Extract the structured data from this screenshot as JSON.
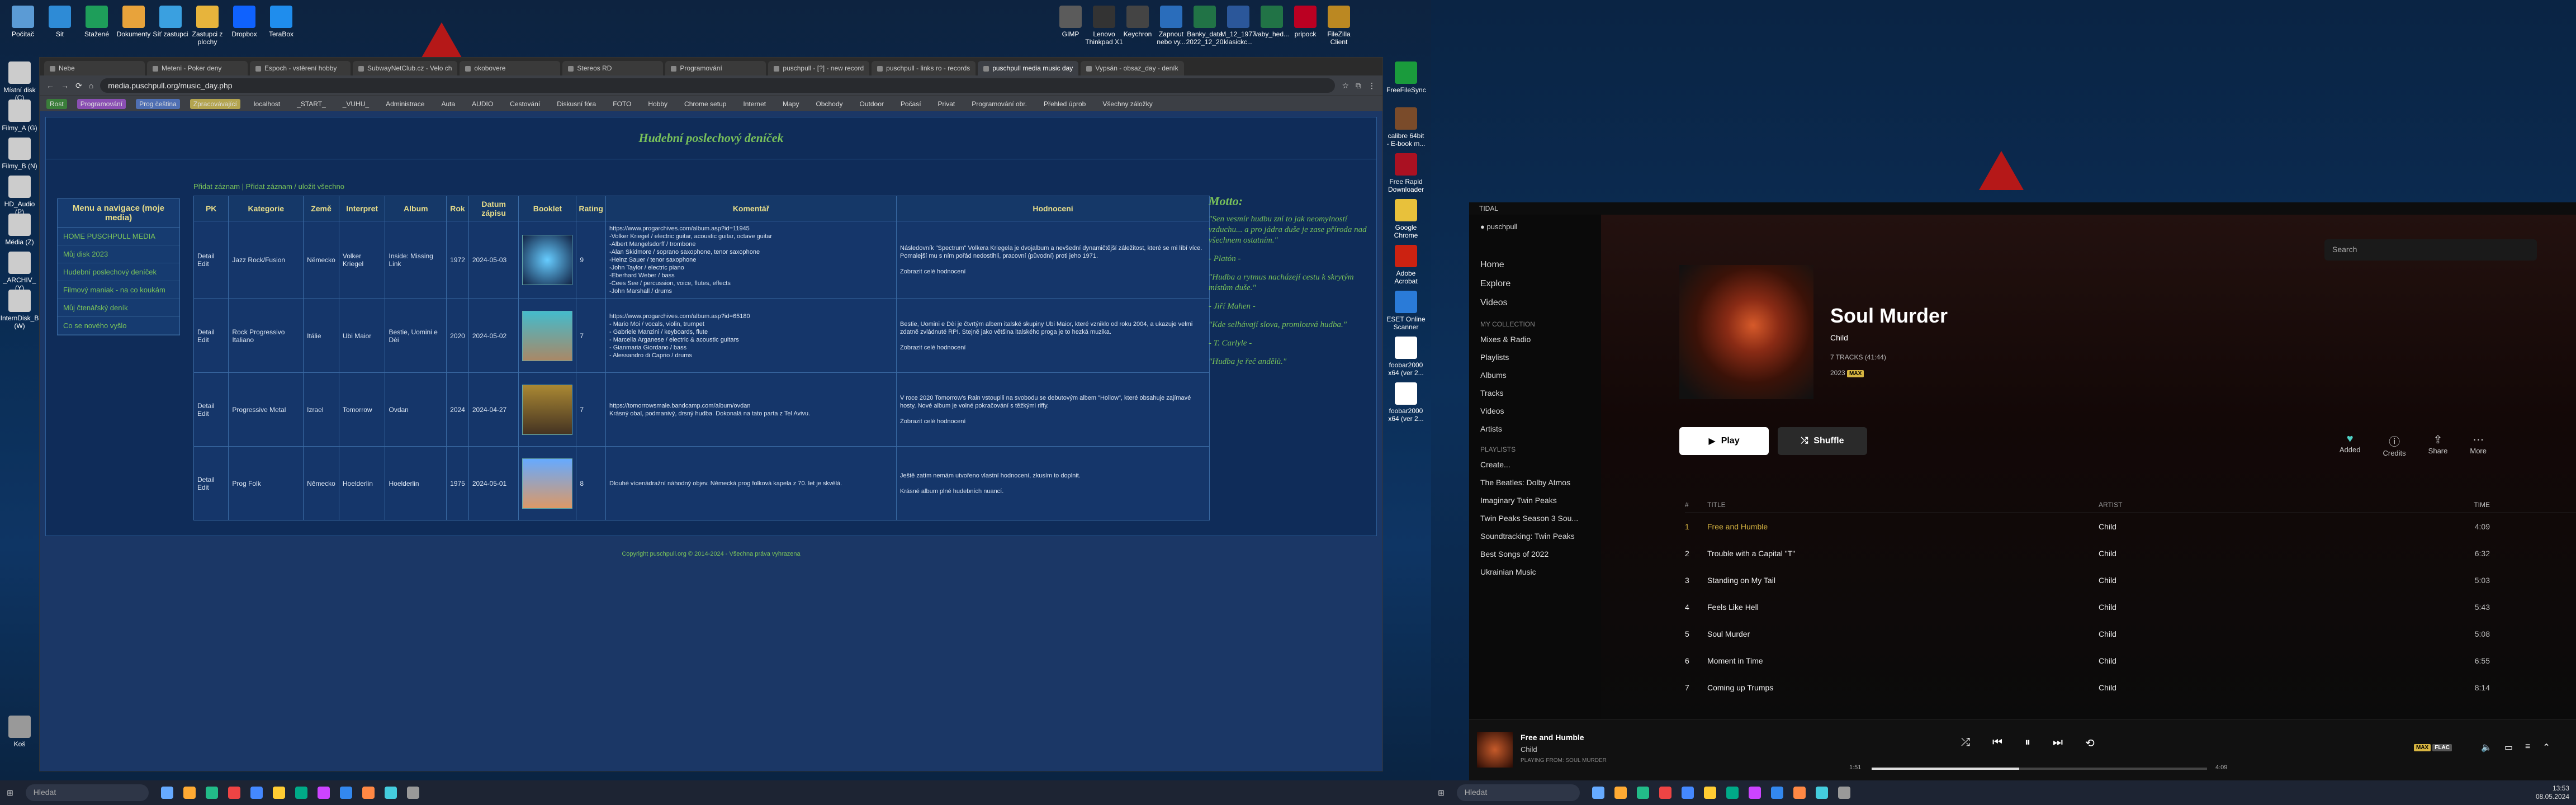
{
  "desktop": {
    "icons_top": [
      "Počítač",
      "Sit",
      "Stažené",
      "Dokumenty",
      "Síť zastupci",
      "Zastupci z plochy",
      "Dropbox",
      "TeraBox"
    ],
    "icons_right_top": [
      "GIMP",
      "Lenovo Thinkpad X1",
      "Keychron",
      "Zapnout nebo vy...",
      "Banky_data 2022_12_20",
      "M_12_1977 klasickc...",
      "vaby_hed...",
      "pripock",
      "FileZilla Client"
    ],
    "icons_left": [
      "Místní disk (C)",
      "Filmy_A (G)",
      "Filmy_B (N)",
      "HD_Audio (P)",
      "Média (Z)",
      "_ARCHIV_ (Y)",
      "InternDisk_B (W)",
      "Koš"
    ],
    "icons_right": [
      "FreeFileSync",
      "calibre 64bit - E-book m...",
      "Free Rapid Downloader",
      "Google Chrome",
      "Adobe Acrobat",
      "ESET Online Scanner",
      "foobar2000 x64 (ver 2...",
      "foobar2000 x64 (ver 2..."
    ]
  },
  "browser": {
    "tabs": [
      "Nebe",
      "Meteni - Poker deny",
      "Espoch - vstěrení hobby",
      "SubwayNetClub.cz - Velo ch",
      "okobovere",
      "Stereos RD",
      "Programování",
      "puschpull - [?] - new record",
      "puschpull - links ro - records",
      "puschpull media music day",
      "Vypsán - obsaz_day - deník"
    ],
    "active_tab": 9,
    "url": "media.puschpull.org/music_day.php",
    "bookmarks": [
      "Rost",
      "Programování",
      "Prog čeština",
      "Zpracovávající",
      "localhost",
      "_START_",
      "_VUHU_",
      "Administrace",
      "Auta",
      "AUDIO",
      "Cestování",
      "Diskusní fóra",
      "FOTO",
      "Hobby",
      "Chrome setup",
      "Internet",
      "Mapy",
      "Obchody",
      "Outdoor",
      "Počasí",
      "Privat",
      "Programování obr.",
      "Přehled úprob",
      "Všechny záložky"
    ]
  },
  "page": {
    "title": "Hudební poslechový deníček",
    "nav": "Přidat záznam   |   Přidat záznam / uložit všechno",
    "menu_title": "Menu a navigace (moje media)",
    "menu": [
      "HOME PUSCHPULL MEDIA",
      "Můj disk 2023",
      "Hudební poslechový deníček",
      "Filmový maniak - na co koukám",
      "Můj čtenářský deník",
      "Co se nového vyšlo"
    ],
    "headers": [
      "PK",
      "Kategorie",
      "Země",
      "Interpret",
      "Album",
      "Rok",
      "Datum zápisu",
      "Booklet",
      "Rating",
      "Komentář",
      "Hodnocení"
    ],
    "rows": [
      {
        "pk": "Detail Edit",
        "cat": "Jazz Rock/Fusion",
        "country": "Německo",
        "artist": "Volker Kriegel",
        "album": "Inside: Missing Link",
        "year": "1972",
        "date": "2024-05-03",
        "rating": "9",
        "comment": "https://www.progarchives.com/album.asp?id=11945\n-Volker Kriegel / electric guitar, acoustic guitar, octave guitar\n-Albert Mangelsdorff / trombone\n-Alan Skidmore / soprano saxophone, tenor saxophone\n-Heinz Sauer / tenor saxophone\n-John Taylor / electric piano\n-Eberhard Weber / bass\n-Cees See / percussion, voice, flutes, effects\n-John Marshall / drums",
        "rev": "Následovník \"Spectrum\" Volkera Kriegela je dvojalbum a nevšední dynamičtější záležitost, které se mi líbí více. Pomalejší mu s ním pořád nedostihli, pracovní (původní) proti jeho 1971.\n\nZobrazit celé hodnocení"
      },
      {
        "pk": "Detail Edit",
        "cat": "Rock Progressivo Italiano",
        "country": "Itálie",
        "artist": "Ubi Maior",
        "album": "Bestie, Uomini e Dèi",
        "year": "2020",
        "date": "2024-05-02",
        "rating": "7",
        "comment": "https://www.progarchives.com/album.asp?id=65180\n- Mario Moi / vocals, violin, trumpet\n- Gabriele Manzini / keyboards, flute\n- Marcella Arganese / electric & acoustic guitars\n- Gianmaria Giordano / bass\n- Alessandro di Caprio / drums",
        "rev": "Bestie, Uomini e Dèi je čtvrtým albem italské skupiny Ubi Maior, které vzniklo od roku 2004, a ukazuje velmi zdatně zvládnuté RPI. Stejně jako většina italského proga je to hezká muzika.\n\nZobrazit celé hodnocení"
      },
      {
        "pk": "Detail Edit",
        "cat": "Progressive Metal",
        "country": "Izrael",
        "artist": "Tomorrow",
        "album": "Ovdan",
        "year": "2024",
        "date": "2024-04-27",
        "rating": "7",
        "comment": "https://tomorrowsmale.bandcamp.com/album/ovdan\nKrásný obal, podmanivý, drsný hudba. Dokonalá na tato parta z Tel Avivu.",
        "rev": "V roce 2020 Tomorrow's Rain vstoupili na svobodu se debutovým albem \"Hollow\", které obsahuje zajímavé hosty. Nové album je volné pokračování s těžkými riffy.\n\nZobrazit celé hodnocení"
      },
      {
        "pk": "Detail Edit",
        "cat": "Prog Folk",
        "country": "Německo",
        "artist": "Hoelderlin",
        "album": "Hoelderlin",
        "year": "1975",
        "date": "2024-05-01",
        "rating": "8",
        "comment": "Dlouhé vícenádražní náhodný objev. Německá prog folková kapela z 70. let je skvělá.",
        "rev": "Ještě zatím nemám utvořeno vlastní hodnocení, zkusím to doplnit.\n\nKrásné album plné hudebních nuancí."
      }
    ],
    "motto_title": "Motto:",
    "motto": [
      "\"Sen vesmír hudbu zní to jak neomylností vzduchu... a pro jádra duše je zase příroda nad všechnem ostatním.\"",
      "- Platón -",
      "\"Hudba a rytmus nacházejí cestu k skrytým místům duše.\"",
      "- Jiří Mahen -",
      "\"Kde selhávají slova, promlouvá hudba.\"",
      "- T. Carlyle -",
      "\"Hudba je řeč andělů.\""
    ],
    "copyright": "Copyright puschpull.org © 2014-2024 - Všechna práva vyhrazena"
  },
  "tidal": {
    "window_title": "TIDAL",
    "user": "puschpull",
    "nav": [
      "Home",
      "Explore",
      "Videos"
    ],
    "collection_title": "MY COLLECTION",
    "collection": [
      "Mixes & Radio",
      "Playlists",
      "Albums",
      "Tracks",
      "Videos",
      "Artists"
    ],
    "playlists_title": "PLAYLISTS",
    "create": "Create...",
    "playlists": [
      "The Beatles: Dolby Atmos",
      "Imaginary Twin Peaks",
      "Twin Peaks Season 3 Sou...",
      "Soundtracking: Twin Peaks",
      "Best Songs of 2022",
      "Ukrainian Music"
    ],
    "search": "Search",
    "album": "Soul Murder",
    "artist": "Child",
    "tracks_meta": "7 TRACKS (41:44)",
    "year": "2023",
    "quality": "MAX",
    "play": "Play",
    "shuffle": "Shuffle",
    "actions": [
      "Added",
      "Credits",
      "Share",
      "More"
    ],
    "cols": [
      "#",
      "TITLE",
      "ARTIST",
      "TIME"
    ],
    "tracks": [
      {
        "n": "1",
        "t": "Free and Humble",
        "a": "Child",
        "d": "4:09"
      },
      {
        "n": "2",
        "t": "Trouble with a Capital \"T\"",
        "a": "Child",
        "d": "6:32"
      },
      {
        "n": "3",
        "t": "Standing on My Tail",
        "a": "Child",
        "d": "5:03"
      },
      {
        "n": "4",
        "t": "Feels Like Hell",
        "a": "Child",
        "d": "5:43"
      },
      {
        "n": "5",
        "t": "Soul Murder",
        "a": "Child",
        "d": "5:08"
      },
      {
        "n": "6",
        "t": "Moment in Time",
        "a": "Child",
        "d": "6:55"
      },
      {
        "n": "7",
        "t": "Coming up Trumps",
        "a": "Child",
        "d": "8:14"
      }
    ],
    "now_title": "Free and Humble",
    "now_artist": "Child",
    "playing_from": "PLAYING FROM: SOUL MURDER",
    "elapsed": "1:51",
    "total": "4:09",
    "now_quality": "MAX",
    "now_format": "FLAC",
    "progress": 0.44
  },
  "taskbar": {
    "search": "Hledat",
    "lang": "CES",
    "kbd": "CSQ",
    "time": "13:53",
    "date": "08.05.2024"
  },
  "colors": {
    "accent_green": "#79c25a",
    "gold": "#e6dc8a",
    "tidal_gold": "#d7b541"
  }
}
